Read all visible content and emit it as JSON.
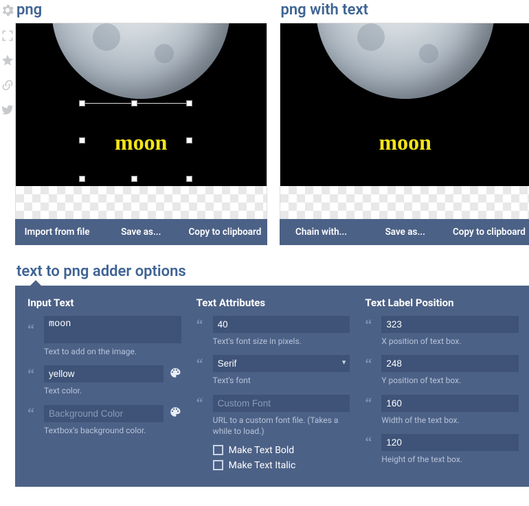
{
  "side_tools": [
    "gear-icon",
    "fullscreen-icon",
    "star-icon",
    "link-icon",
    "twitter-icon"
  ],
  "panels": {
    "source": {
      "title": "png",
      "text_overlay": "moon",
      "actions": [
        "Import from file",
        "Save as...",
        "Copy to clipboard"
      ]
    },
    "result": {
      "title": "png with text",
      "text_overlay": "moon",
      "actions": [
        "Chain with...",
        "Save as...",
        "Copy to clipboard"
      ]
    }
  },
  "options_title": "text to png adder options",
  "options": {
    "col1": {
      "title": "Input Text",
      "text_value": "moon",
      "text_desc": "Text to add on the image.",
      "color_value": "yellow",
      "color_desc": "Text color.",
      "bg_placeholder": "Background Color",
      "bg_desc": "Textbox's background color."
    },
    "col2": {
      "title": "Text Attributes",
      "size_value": "40",
      "size_desc": "Text's font size in pixels.",
      "font_value": "Serif",
      "font_desc": "Text's font",
      "customfont_placeholder": "Custom Font",
      "customfont_desc": "URL to a custom font file. (Takes a while to load.)",
      "bold_label": "Make Text Bold",
      "italic_label": "Make Text Italic"
    },
    "col3": {
      "title": "Text Label Position",
      "x_value": "323",
      "x_desc": "X position of text box.",
      "y_value": "248",
      "y_desc": "Y position of text box.",
      "w_value": "160",
      "w_desc": "Width of the text box.",
      "h_value": "120",
      "h_desc": "Height of the text box."
    }
  }
}
